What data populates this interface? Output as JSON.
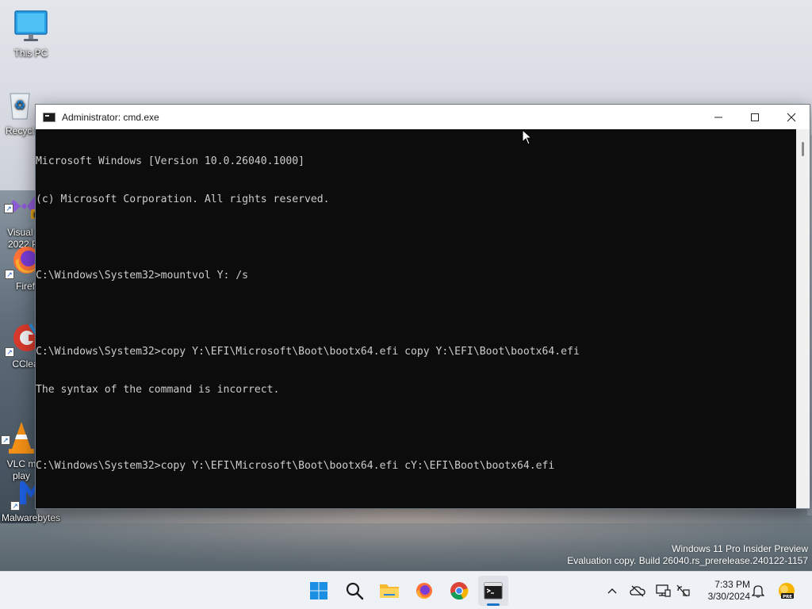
{
  "desktop": {
    "icons": [
      {
        "label": "This PC"
      },
      {
        "label": "Recycl"
      },
      {
        "label": "Visual S\n2022 Pr"
      },
      {
        "label": "Firef"
      },
      {
        "label": "CClea"
      },
      {
        "label": "VLC m\nplay"
      },
      {
        "label": "Malwarebytes"
      }
    ]
  },
  "window": {
    "title": "Administrator: cmd.exe",
    "controls": {
      "minimize": "minimize",
      "maximize": "maximize",
      "close": "close"
    }
  },
  "console": {
    "lines": [
      "Microsoft Windows [Version 10.0.26040.1000]",
      "(c) Microsoft Corporation. All rights reserved.",
      "",
      "C:\\Windows\\System32>mountvol Y: /s",
      "",
      "C:\\Windows\\System32>copy Y:\\EFI\\Microsoft\\Boot\\bootx64.efi copy Y:\\EFI\\Boot\\bootx64.efi",
      "The syntax of the command is incorrect.",
      "",
      "C:\\Windows\\System32>copy Y:\\EFI\\Microsoft\\Boot\\bootx64.efi cY:\\EFI\\Boot\\bootx64.efi"
    ]
  },
  "watermark": {
    "line1": "Windows 11 Pro Insider Preview",
    "line2": "Evaluation copy. Build 26040.rs_prerelease.240122-1157"
  },
  "taskbar": {
    "apps": [
      "start-icon",
      "search-icon",
      "file-explorer-icon",
      "firefox-icon",
      "chrome-icon",
      "terminal-icon"
    ],
    "tray": [
      "chevron-up-icon",
      "onedrive-icon",
      "display-icon",
      "network-icon",
      "notification-bell-icon",
      "copilot-pre-icon"
    ],
    "tray_badge": "PRE",
    "time": "7:33 PM",
    "date": "3/30/2024"
  },
  "colors": {
    "console_bg": "#0c0c0c",
    "console_fg": "#cccccc",
    "accent": "#1a73c7"
  }
}
